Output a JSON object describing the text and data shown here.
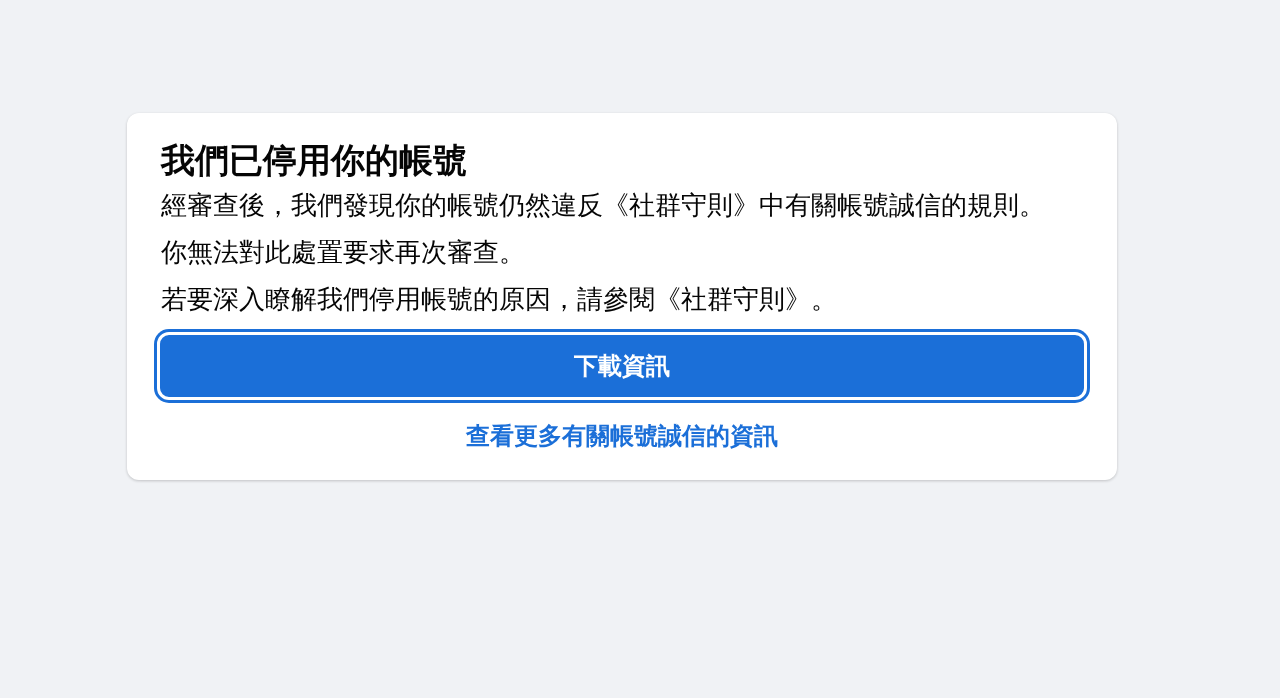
{
  "dialog": {
    "title": "我們已停用你的帳號",
    "paragraphs": [
      "經審查後，我們發現你的帳號仍然違反《社群守則》中有關帳號誠信的規則。",
      "你無法對此處置要求再次審查。",
      "若要深入瞭解我們停用帳號的原因，請參閱《社群守則》。"
    ],
    "button": {
      "label": "下載資訊",
      "focused": true
    },
    "link": "查看更多有關帳號誠信的資訊"
  }
}
